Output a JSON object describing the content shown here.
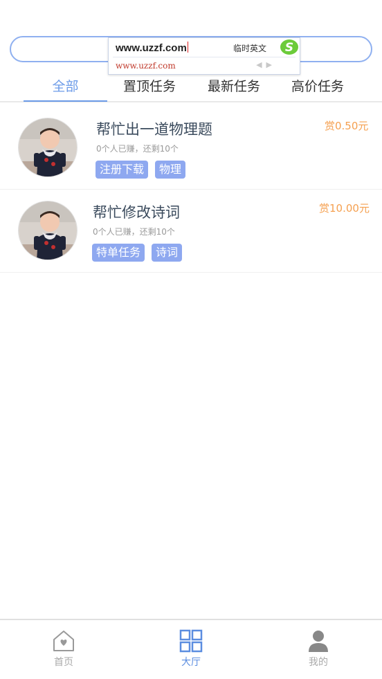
{
  "search": {
    "ime_input": "www.uzzf.com",
    "ime_mode": "临时英文",
    "ime_candidate": "www.uzzf.com"
  },
  "tabs": [
    {
      "label": "全部",
      "active": true
    },
    {
      "label": "置顶任务",
      "active": false
    },
    {
      "label": "最新任务",
      "active": false
    },
    {
      "label": "高价任务",
      "active": false
    }
  ],
  "tasks": [
    {
      "title": "帮忙出一道物理题",
      "meta": "0个人已赚，还剩10个",
      "reward": "赏0.50元",
      "tags": [
        "注册下载",
        "物理"
      ]
    },
    {
      "title": "帮忙修改诗词",
      "meta": "0个人已赚，还剩10个",
      "reward": "赏10.00元",
      "tags": [
        "特单任务",
        "诗词"
      ]
    }
  ],
  "bottom_nav": {
    "home": {
      "label": "首页",
      "icon": "home-icon"
    },
    "hall": {
      "label": "大厅",
      "icon": "grid-icon"
    },
    "mine": {
      "label": "我的",
      "icon": "user-icon"
    }
  },
  "colors": {
    "accent": "#6c9be8",
    "tag_bg": "#8ea8f0",
    "reward": "#f5a050"
  }
}
